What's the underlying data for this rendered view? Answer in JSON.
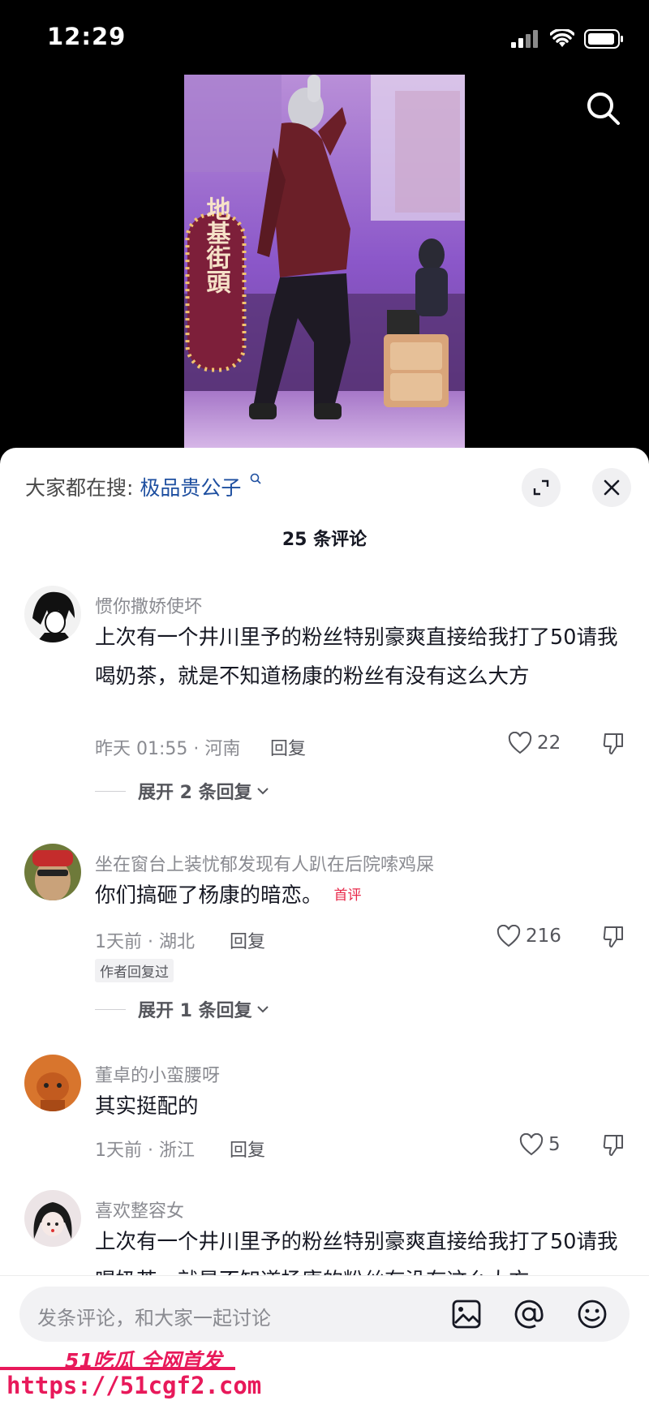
{
  "status_bar": {
    "time": "12:29"
  },
  "video": {
    "sign_text": "地基街頭"
  },
  "hot_search": {
    "prefix": "大家都在搜:",
    "keyword": "极品贵公子"
  },
  "comments_count": "25 条评论",
  "comments": [
    {
      "user": "惯你撒娇使坏",
      "text": "上次有一个井川里予的粉丝特别豪爽直接给我打了50请我喝奶茶，就是不知道杨康的粉丝有没有这么大方",
      "meta": "昨天 01:55 · 河南",
      "reply": "回复",
      "likes": "22",
      "expand": "展开 2 条回复"
    },
    {
      "user": "坐在窗台上装忧郁发现有人趴在后院嗦鸡屎",
      "text": "你们搞砸了杨康的暗恋。",
      "tag": "首评",
      "meta": "1天前 · 湖北",
      "reply": "回复",
      "likes": "216",
      "author_tag": "作者回复过",
      "expand": "展开 1 条回复"
    },
    {
      "user": "董卓的小蛮腰呀",
      "text": "其实挺配的",
      "meta": "1天前 · 浙江",
      "reply": "回复",
      "likes": "5"
    },
    {
      "user": "喜欢整容女",
      "text": "上次有一个井川里予的粉丝特别豪爽直接给我打了50请我喝奶茶，就是不知道杨康的粉丝有没有这么大方"
    }
  ],
  "input": {
    "placeholder": "发条评论，和大家一起讨论"
  },
  "watermark": {
    "brand": "51吃瓜 全网首发",
    "url": "https://51cgf2.com"
  },
  "colors": {
    "accent": "#e8294a",
    "keyword": "#1e4fa0",
    "watermark": "#e8195a"
  },
  "icons": [
    "search-icon",
    "expand-icon",
    "close-icon",
    "heart-icon",
    "dislike-icon",
    "image-icon",
    "at-icon",
    "emoji-icon",
    "wifi-icon",
    "battery-icon",
    "signal-icon"
  ]
}
